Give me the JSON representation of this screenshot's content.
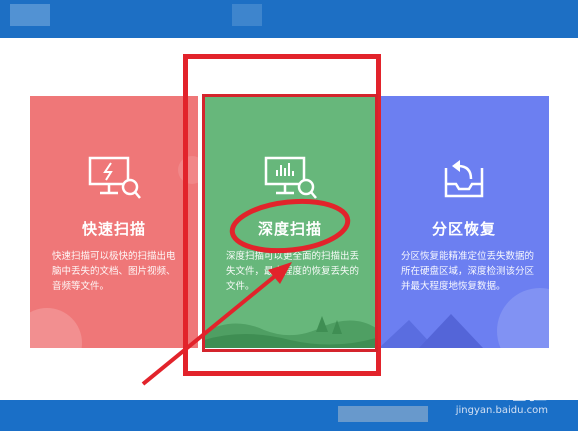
{
  "cards": [
    {
      "title": "快速扫描",
      "desc": "快速扫描可以极快的扫描出电脑中丢失的文档、图片视频、音频等文件。",
      "color": "#ef7778",
      "icon": "monitor-lightning-search-icon"
    },
    {
      "title": "深度扫描",
      "desc": "深度扫描可以更全面的扫描出丢失文件，最大程度的恢复丢失的文件。",
      "color": "#67b77b",
      "icon": "monitor-chart-search-icon"
    },
    {
      "title": "分区恢复",
      "desc": "分区恢复能精准定位丢失数据的所在硬盘区域，深度检测该分区并最大程度地恢复数据。",
      "color": "#6c7ff1",
      "icon": "tray-return-icon"
    }
  ],
  "watermark": {
    "brand": "Baidu 经验",
    "url": "jingyan.baidu.com"
  },
  "colors": {
    "header": "#1d6fc4",
    "annotation": "#e2232b"
  }
}
